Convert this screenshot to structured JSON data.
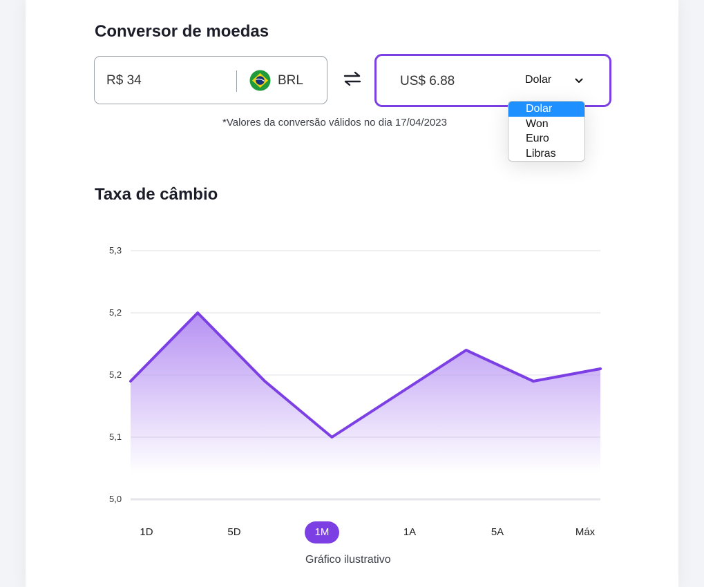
{
  "converter": {
    "title": "Conversor de moedas",
    "from_amount": "R$ 34",
    "from_currency": "BRL",
    "to_amount": "US$ 6.88",
    "to_currency": "Dolar",
    "options": [
      "Dolar",
      "Won",
      "Euro",
      "Libras"
    ],
    "selected_option": "Dolar",
    "note": "*Valores da conversão válidos no dia 17/04/2023"
  },
  "exchange": {
    "title": "Taxa de câmbio",
    "ranges": [
      "1D",
      "5D",
      "1M",
      "1A",
      "5A",
      "Máx"
    ],
    "active_range": "1M",
    "caption": "Gráfico ilustrativo"
  },
  "colors": {
    "accent": "#7b3fe4",
    "fill_top": "#b28bf2",
    "grid": "#e2e2e6",
    "selected_option_bg": "#1e90ff"
  },
  "icons": {
    "swap": "swap-arrows-icon",
    "flag": "brazil-flag-icon",
    "chevron": "chevron-down-icon"
  },
  "chart_data": {
    "type": "area",
    "x": [
      0,
      1,
      2,
      3,
      4,
      5,
      6,
      7
    ],
    "values": [
      5.19,
      5.3,
      5.19,
      5.1,
      5.17,
      5.24,
      5.19,
      5.21
    ],
    "yticks": [
      5.0,
      5.1,
      5.2,
      5.2,
      5.3
    ],
    "ytick_labels": [
      "5,0",
      "5,1",
      "5,2",
      "5,2",
      "5,3"
    ],
    "ylim": [
      5.0,
      5.4
    ],
    "grid": true,
    "legend": "none"
  }
}
